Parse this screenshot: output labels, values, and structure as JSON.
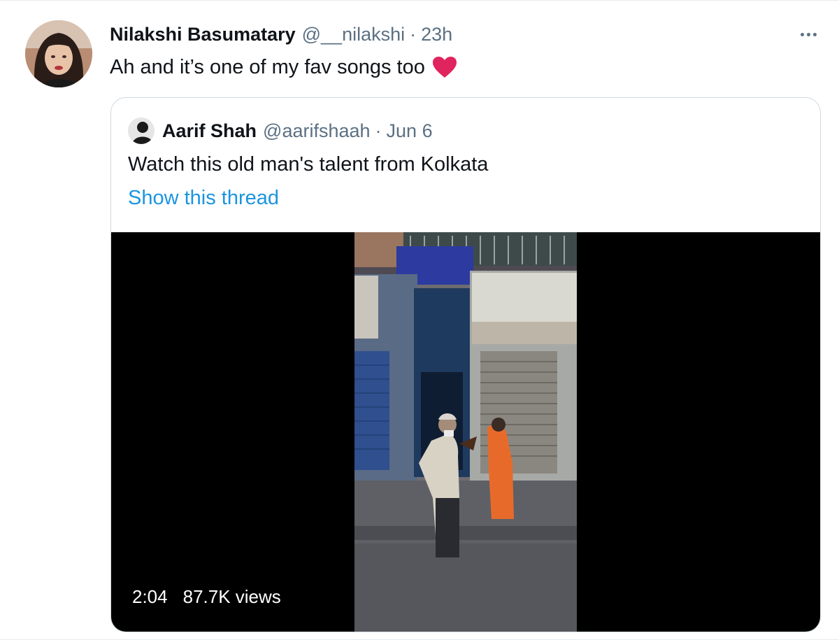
{
  "tweet": {
    "author_name": "Nilakshi Basumatary",
    "author_handle": "@__nilakshi",
    "separator": "·",
    "time": "23h",
    "text": "Ah and it’s one of my fav songs too",
    "emoji_icon": "red-heart-icon"
  },
  "quoted_tweet": {
    "author_name": "Aarif Shah",
    "author_handle": "@aarifshaah",
    "separator": "·",
    "date": "Jun 6",
    "text": "Watch this old man's talent from Kolkata",
    "show_thread_label": "Show this thread",
    "video": {
      "duration": "2:04",
      "views": "87.7K views"
    }
  },
  "colors": {
    "secondary_text": "#5b7083",
    "link": "#1b95e0",
    "border": "#cfd9de",
    "heart": "#e0245e"
  }
}
